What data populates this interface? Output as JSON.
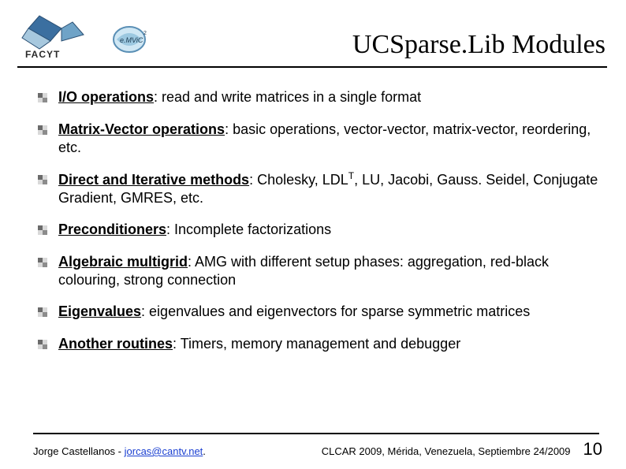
{
  "header": {
    "title": "UCSparse.Lib Modules"
  },
  "items": [
    {
      "bold": "I/O operations",
      "rest": ": read and write matrices in a single format"
    },
    {
      "bold": "Matrix-Vector operations",
      "rest": ": basic operations, vector-vector, matrix-vector, reordering, etc."
    },
    {
      "bold": "Direct and Iterative methods",
      "rest_pre": ": Cholesky, LDL",
      "sup": "T",
      "rest_post": ", LU, Jacobi, Gauss. Seidel, Conjugate Gradient, GMRES, etc."
    },
    {
      "bold": "Preconditioners",
      "rest": ": Incomplete factorizations"
    },
    {
      "bold": "Algebraic multigrid",
      "rest": ": AMG with different setup phases: aggregation, red-black colouring, strong connection"
    },
    {
      "bold": "Eigenvalues",
      "rest": ": eigenvalues and eigenvectors for sparse symmetric matrices"
    },
    {
      "bold": "Another routines",
      "rest": ": Timers, memory management and debugger"
    }
  ],
  "footer": {
    "author": "Jorge Castellanos - ",
    "email": "jorcas@cantv.net",
    "email_dot": ".",
    "venue": "CLCAR 2009, Mérida, Venezuela, Septiembre 24/2009",
    "page": "10"
  }
}
